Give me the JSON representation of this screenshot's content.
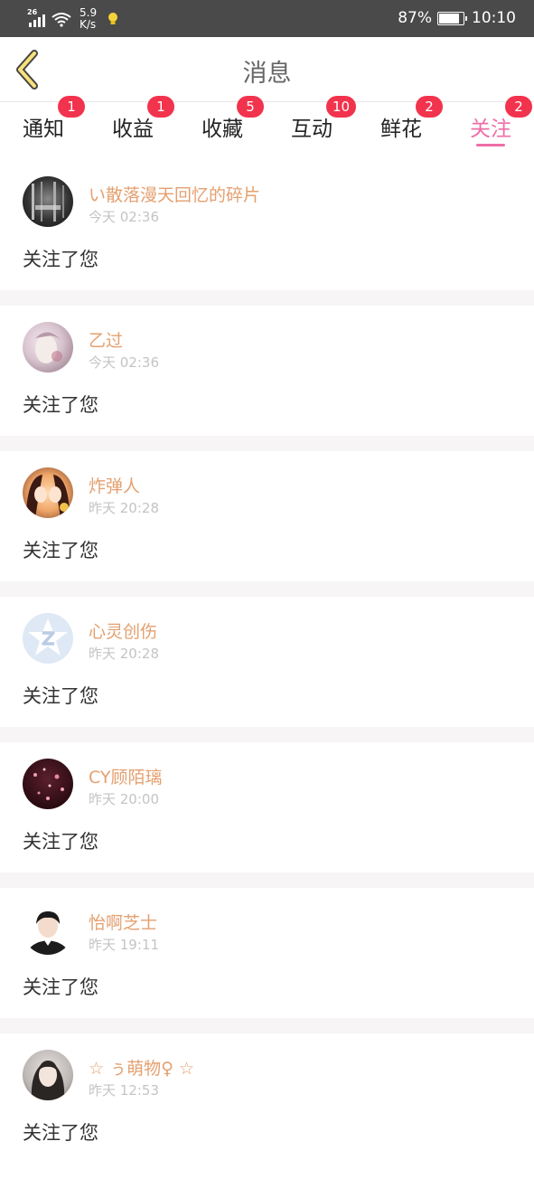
{
  "status_bar": {
    "network": "26",
    "speed_value": "5.9",
    "speed_unit": "K/s",
    "battery": "87%",
    "battery_level": 0.87,
    "time": "10:10"
  },
  "header": {
    "title": "消息",
    "back_icon": "chevron-left-icon"
  },
  "tabs": [
    {
      "label": "通知",
      "badge": "1",
      "active": false
    },
    {
      "label": "收益",
      "badge": "1",
      "active": false
    },
    {
      "label": "收藏",
      "badge": "5",
      "active": false
    },
    {
      "label": "互动",
      "badge": "10",
      "active": false
    },
    {
      "label": "鲜花",
      "badge": "2",
      "active": false
    },
    {
      "label": "关注",
      "badge": "2",
      "active": true
    }
  ],
  "colors": {
    "accent_pink": "#ee6ea7",
    "badge_red": "#f2334d",
    "username": "#e4a06f"
  },
  "messages": [
    {
      "name": "い散落漫天回忆的碎片",
      "time": "今天 02:36",
      "text": "关注了您"
    },
    {
      "name": "乙过",
      "time": "今天 02:36",
      "text": "关注了您"
    },
    {
      "name": "炸弹人",
      "time": "昨天 20:28",
      "text": "关注了您"
    },
    {
      "name": "心灵创伤",
      "time": "昨天 20:28",
      "text": "关注了您"
    },
    {
      "name": "CY顾陌璃",
      "time": "昨天 20:00",
      "text": "关注了您"
    },
    {
      "name": "怡啊芝士",
      "time": "昨天 19:11",
      "text": "关注了您"
    },
    {
      "name": "☆ ぅ萌物♀ ☆",
      "time": "昨天 12:53",
      "text": "关注了您"
    }
  ]
}
